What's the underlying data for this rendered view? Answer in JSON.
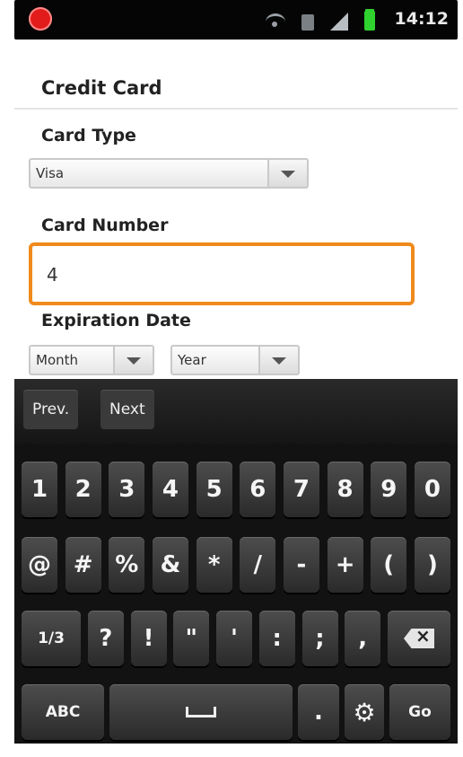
{
  "status_bar": {
    "time": "14:12",
    "icons": [
      "record-icon",
      "wifi-icon",
      "sd-card-icon",
      "signal-icon",
      "battery-icon"
    ]
  },
  "form": {
    "title": "Credit Card",
    "card_type": {
      "label": "Card Type",
      "value": "Visa"
    },
    "card_number": {
      "label": "Card Number",
      "value": "4"
    },
    "expiration": {
      "label": "Expiration Date",
      "month": "Month",
      "year": "Year"
    }
  },
  "keyboard": {
    "nav": {
      "prev": "Prev.",
      "next": "Next"
    },
    "row1": [
      "1",
      "2",
      "3",
      "4",
      "5",
      "6",
      "7",
      "8",
      "9",
      "0"
    ],
    "row2": [
      "@",
      "#",
      "%",
      "&",
      "*",
      "/",
      "-",
      "+",
      "(",
      ")"
    ],
    "row3": [
      "1/3",
      "?",
      "!",
      "\"",
      "'",
      ":",
      ";",
      ","
    ],
    "row4": {
      "abc": "ABC",
      "dot": ".",
      "go": "Go"
    }
  }
}
